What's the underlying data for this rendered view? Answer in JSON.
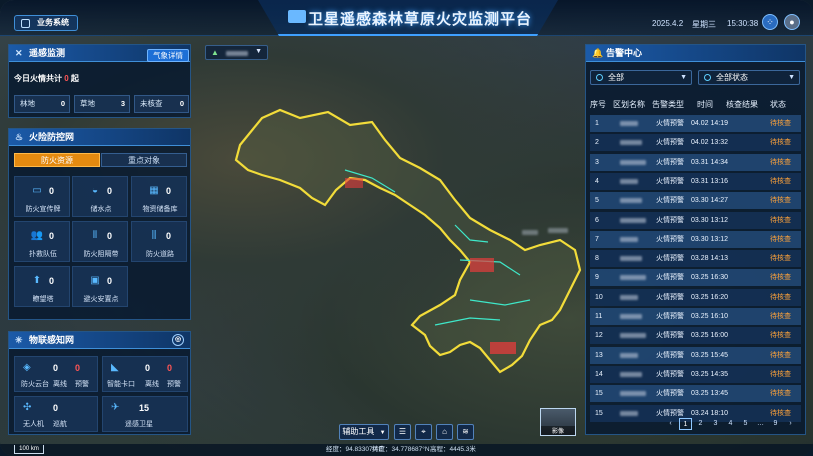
{
  "header": {
    "biz_label": "业务系统",
    "title": "卫星遥感森林草原火灾监测平台",
    "date": "2025.4.2",
    "weekday": "星期三",
    "time": "15:30:38"
  },
  "remote_sensing": {
    "title": "遥感监测",
    "detail_button": "气象详情",
    "today_prefix": "今日火情共计",
    "today_count": "0",
    "today_suffix": "起",
    "stats": [
      {
        "label": "林地",
        "value": "0"
      },
      {
        "label": "草地",
        "value": "3"
      },
      {
        "label": "未核查",
        "value": "0"
      }
    ]
  },
  "fire_prevention": {
    "title": "火险防控网",
    "tabs": [
      "防火资源",
      "重点对象"
    ],
    "resources": [
      {
        "label": "防火宣传牌",
        "value": "0"
      },
      {
        "label": "储水点",
        "value": "0"
      },
      {
        "label": "物资储备库",
        "value": "0"
      },
      {
        "label": "扑救队伍",
        "value": "0"
      },
      {
        "label": "防火阻隔带",
        "value": "0"
      },
      {
        "label": "防火道路",
        "value": "0"
      },
      {
        "label": "瞭望塔",
        "value": "0"
      },
      {
        "label": "避火安置点",
        "value": "0"
      }
    ]
  },
  "iot": {
    "title": "物联感知网",
    "items": [
      {
        "label": "防火云台",
        "v1": "0",
        "v2": "0",
        "l1": "离线",
        "l2": "预警"
      },
      {
        "label": "智能卡口",
        "v1": "0",
        "v2": "0",
        "l1": "离线",
        "l2": "预警"
      },
      {
        "label": "无人机",
        "v1": "0",
        "l1": "巡航"
      },
      {
        "label": "遥感卫星",
        "v1": "15"
      }
    ]
  },
  "alerts": {
    "title": "告警中心",
    "filter_region": "全部",
    "filter_status": "全部状态",
    "columns": [
      "序号",
      "区划名称",
      "告警类型",
      "时间",
      "核查结果",
      "状态"
    ],
    "rows": [
      {
        "no": "1",
        "type": "火情预警",
        "time": "04.02 14:19",
        "status": "待核查"
      },
      {
        "no": "2",
        "type": "火情预警",
        "time": "04.02 13:32",
        "status": "待核查"
      },
      {
        "no": "3",
        "type": "火情预警",
        "time": "03.31 14:34",
        "status": "待核查"
      },
      {
        "no": "4",
        "type": "火情预警",
        "time": "03.31 13:16",
        "status": "待核查"
      },
      {
        "no": "5",
        "type": "火情预警",
        "time": "03.30 14:27",
        "status": "待核查"
      },
      {
        "no": "6",
        "type": "火情预警",
        "time": "03.30 13:12",
        "status": "待核查"
      },
      {
        "no": "7",
        "type": "火情预警",
        "time": "03.30 13:12",
        "status": "待核查"
      },
      {
        "no": "8",
        "type": "火情预警",
        "time": "03.28 14:13",
        "status": "待核查"
      },
      {
        "no": "9",
        "type": "火情预警",
        "time": "03.25 16:30",
        "status": "待核查"
      },
      {
        "no": "10",
        "type": "火情预警",
        "time": "03.25 16:20",
        "status": "待核查"
      },
      {
        "no": "11",
        "type": "火情预警",
        "time": "03.25 16:10",
        "status": "待核查"
      },
      {
        "no": "12",
        "type": "火情预警",
        "time": "03.25 16:00",
        "status": "待核查"
      },
      {
        "no": "13",
        "type": "火情预警",
        "time": "03.25 15:45",
        "status": "待核查"
      },
      {
        "no": "14",
        "type": "火情预警",
        "time": "03.25 14:35",
        "status": "待核查"
      },
      {
        "no": "15",
        "type": "火情预警",
        "time": "03.25 13:45",
        "status": "待核查"
      },
      {
        "no": "15",
        "type": "火情预警",
        "time": "03.24 18:10",
        "status": "待核查"
      }
    ],
    "pager": [
      "‹",
      "1",
      "2",
      "3",
      "4",
      "5",
      "…",
      "9",
      "›"
    ]
  },
  "toolbar": {
    "assist_tools": "辅助工具",
    "imagery": "影像"
  },
  "status": {
    "scale": "100 km",
    "lon": "经度：94.833079°E",
    "lat": "纬度：34.778687°N",
    "alt": "高程：4445.3米"
  },
  "colors": {
    "accent": "#1d6fd6",
    "warning": "#ff5555",
    "pending": "#ffa33a",
    "active_tab": "#e48a10"
  }
}
